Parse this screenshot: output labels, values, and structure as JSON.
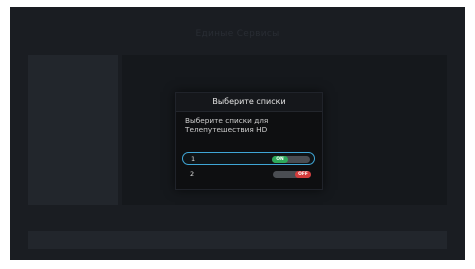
{
  "background": {
    "title": "Единые Сервисы"
  },
  "dialog": {
    "title": "Выберите списки",
    "message": "Выберите списки для Телепутешествия HD",
    "items": [
      {
        "number": "1",
        "state": "ON",
        "focused": true
      },
      {
        "number": "2",
        "state": "OFF",
        "focused": false
      }
    ]
  },
  "colors": {
    "screen_bg": "#1a1d22",
    "dialog_bg": "#0e0f11",
    "focus_border": "#3fa6d6",
    "toggle_on": "#2ea95a",
    "toggle_off": "#d33b3b",
    "toggle_track": "#4a4d52"
  }
}
